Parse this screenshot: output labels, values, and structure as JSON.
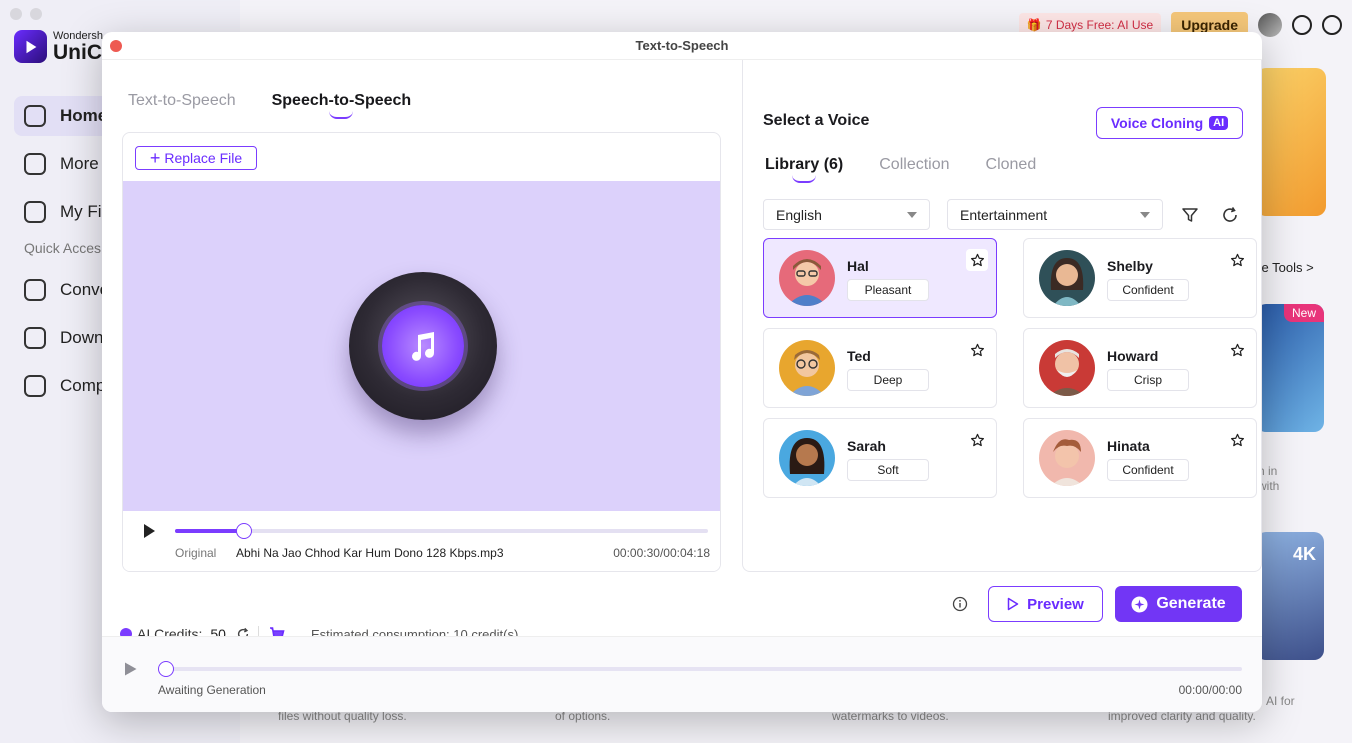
{
  "background": {
    "brand": {
      "small": "Wondersh",
      "big": "UniCo"
    },
    "nav": [
      {
        "label": "Home",
        "active": true
      },
      {
        "label": "More T",
        "active": false
      },
      {
        "label": "My Fil",
        "active": false
      }
    ],
    "quick_access_label": "Quick Acces",
    "quick_items": [
      "Conve",
      "Downl",
      "Comp"
    ],
    "promo": "7 Days Free: AI Use",
    "upgrade": "Upgrade",
    "more_tools": "ore Tools >",
    "new_badge": "New",
    "fourk": "4K",
    "snippets": {
      "a": "h in",
      "b": "with",
      "c": "AI for",
      "d": "improved clarity and quality.",
      "e": "files without quality loss.",
      "f": "of options.",
      "g": "watermarks to videos."
    }
  },
  "modal": {
    "title": "Text-to-Speech",
    "tabs": [
      {
        "label": "Text-to-Speech",
        "active": false
      },
      {
        "label": "Speech-to-Speech",
        "active": true
      }
    ],
    "replace_file": "Replace File",
    "player": {
      "original_label": "Original",
      "file_name": "Abhi Na Jao Chhod Kar Hum Dono 128 Kbps.mp3",
      "time": "00:00:30/00:04:18",
      "progress_fraction": 0.13
    },
    "credits": {
      "label": "AI Credits:",
      "value": "50",
      "estimated": "Estimated consumption: 10 credit(s)"
    },
    "voice_panel": {
      "title": "Select a Voice",
      "clone_button": "Voice Cloning",
      "ai_chip": "AI",
      "tabs": [
        {
          "label": "Library (6)",
          "active": true
        },
        {
          "label": "Collection",
          "active": false
        },
        {
          "label": "Cloned",
          "active": false
        }
      ],
      "language": "English",
      "category": "Entertainment",
      "voices": [
        {
          "name": "Hal",
          "tag": "Pleasant",
          "selected": true
        },
        {
          "name": "Shelby",
          "tag": "Confident",
          "selected": false
        },
        {
          "name": "Ted",
          "tag": "Deep",
          "selected": false
        },
        {
          "name": "Howard",
          "tag": "Crisp",
          "selected": false
        },
        {
          "name": "Sarah",
          "tag": "Soft",
          "selected": false
        },
        {
          "name": "Hinata",
          "tag": "Confident",
          "selected": false
        }
      ]
    },
    "preview_button": "Preview",
    "generate_button": "Generate",
    "output": {
      "status": "Awaiting Generation",
      "time": "00:00/00:00"
    }
  },
  "colors": {
    "accent": "#7b3cff",
    "accent_dark": "#6a2cff",
    "art_bg": "#dcd1fb",
    "selected_card": "#efe8ff"
  },
  "icons": [
    "play-icon",
    "music-note-icon",
    "plus-icon",
    "star-icon",
    "filter-icon",
    "refresh-icon",
    "cart-icon",
    "info-icon",
    "preview-play-icon",
    "generate-icon",
    "caret-down-icon"
  ]
}
